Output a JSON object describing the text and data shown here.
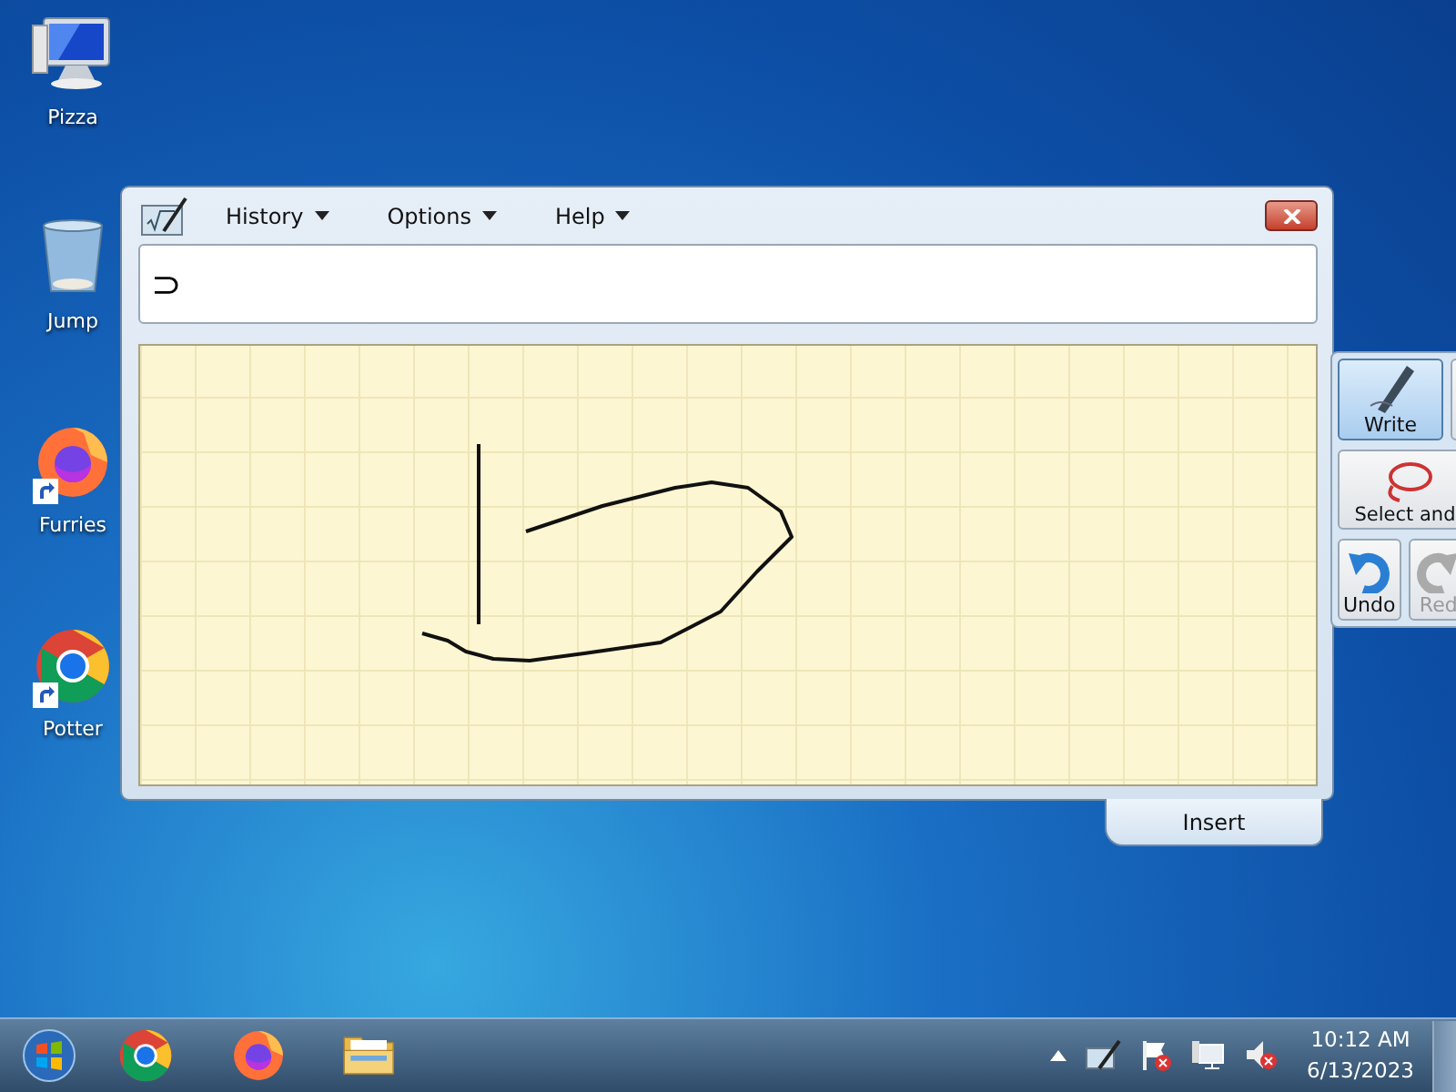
{
  "desktop_icons": [
    {
      "label": "Pizza",
      "kind": "computer",
      "shortcut": false
    },
    {
      "label": "Jump",
      "kind": "recycle-bin",
      "shortcut": false
    },
    {
      "label": "Furries",
      "kind": "firefox",
      "shortcut": true
    },
    {
      "label": "Potter",
      "kind": "chrome",
      "shortcut": true
    }
  ],
  "window": {
    "menu": [
      {
        "label": "History"
      },
      {
        "label": "Options"
      },
      {
        "label": "Help"
      }
    ],
    "preview": {
      "text": "⊃"
    },
    "insert_button": "Insert"
  },
  "mode_tools": [
    {
      "label": "Write",
      "kind": "write",
      "selected": true
    },
    {
      "label": "Select and",
      "kind": "select",
      "selected": false
    }
  ],
  "edit_tools": [
    {
      "label": "Undo",
      "kind": "undo",
      "disabled": false
    },
    {
      "label": "Red",
      "kind": "redo",
      "disabled": true
    }
  ],
  "taskbar": {
    "pinned": [
      {
        "kind": "chrome"
      },
      {
        "kind": "firefox"
      },
      {
        "kind": "explorer"
      }
    ],
    "clock": {
      "time": "10:12 AM",
      "date": "6/13/2023"
    }
  }
}
